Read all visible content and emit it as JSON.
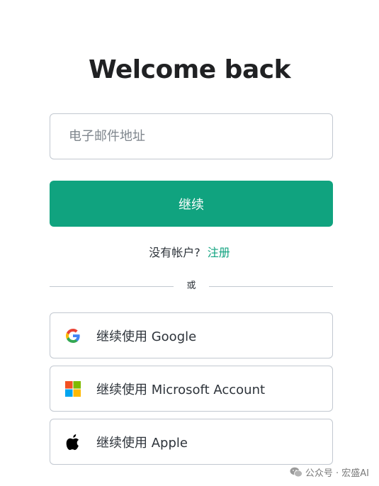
{
  "header": {
    "title": "Welcome back"
  },
  "form": {
    "email_placeholder": "电子邮件地址",
    "email_value": "",
    "continue_label": "继续"
  },
  "signup": {
    "prompt": "没有帐户?",
    "link_label": "注册"
  },
  "divider": {
    "label": "或"
  },
  "social": {
    "google_label": "继续使用 Google",
    "microsoft_label": "继续使用 Microsoft Account",
    "apple_label": "继续使用 Apple"
  },
  "watermark": {
    "text": "公众号 · 宏盛AI"
  },
  "colors": {
    "accent": "#10a37f",
    "border": "#c2c8d0",
    "text": "#2d333a"
  },
  "icons": {
    "google": "google-logo-icon",
    "microsoft": "microsoft-logo-icon",
    "apple": "apple-logo-icon",
    "watermark": "wechat-icon"
  }
}
